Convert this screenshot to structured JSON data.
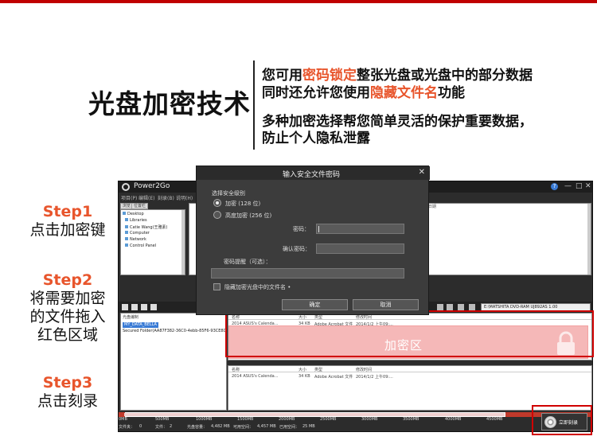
{
  "header": {
    "title": "光盘加密技术",
    "line1_pre": "您可用",
    "line1_hl": "密码锁定",
    "line1_post": "整张光盘或光盘中的部分数据",
    "line2_pre": "同时还允许您使用",
    "line2_hl": "隐藏文件名",
    "line2_post": "功能",
    "line3": "多种加密选择帮您简单灵活的保护重要数据，",
    "line4": "防止个人隐私泄露",
    "highlight_color": "#e8552c"
  },
  "steps": [
    {
      "head": "Step1",
      "lines": [
        "点击加密键"
      ]
    },
    {
      "head": "Step2",
      "lines": [
        "将需要加密",
        "的文件拖入",
        "红色区域"
      ]
    },
    {
      "head": "Step3",
      "lines": [
        "点击刻录"
      ]
    }
  ],
  "app": {
    "name": "Power2Go",
    "menu": [
      "项目(P)",
      "编辑(E)",
      "刻录(B)",
      "说明(H)"
    ],
    "tabs": [
      "浏览",
      "位置栏"
    ],
    "tree": [
      "Desktop",
      "Libraries",
      "Catie Wang(王雅素)",
      "Computer",
      "Network",
      "Control Panel"
    ],
    "top_right_col": "日期",
    "drive": "E:\\MATSHITA DVD-RAM UJ892AS 1.00",
    "left_pane_header": "光盘编制",
    "selected_item": "MY_DATA_BELLA",
    "left_item": "Secured Folder(AA87F382-36C0-4ebb-85F6-93CE8DB3",
    "columns": [
      "名称",
      "大小",
      "类型",
      "修改时间"
    ],
    "row": [
      "2014 ASUS's Calenda...",
      "34 KB",
      "Adobe Acrobat 文件",
      "2014/1/2 上午09:..."
    ],
    "encrypt_zone_label": "加密区",
    "columns2": [
      "名称",
      "大小",
      "类型",
      "修改时间"
    ],
    "row2": [
      "2014 ASUS's Calenda...",
      "34 KB",
      "Adobe Acrobat 文件",
      "2014/1/2 上午09:..."
    ],
    "scale": [
      "0MB",
      "500MB",
      "1000MB",
      "1500MB",
      "2000MB",
      "2500MB",
      "3000MB",
      "3500MB",
      "4000MB",
      "4500MB"
    ],
    "stats": [
      "文件夹：",
      "0",
      "文件：",
      "2",
      "光盘容量：",
      "4,482 MB",
      "可用空间：",
      "4,457 MB",
      "已用空间：",
      "25 MB"
    ],
    "burn_label": "立即刻录"
  },
  "dialog": {
    "title": "输入安全文件密码",
    "close": "✕",
    "security_level": "选择安全级别",
    "option1": "加密 (128 位)",
    "option2": "高度加密 (256 位)",
    "password_label": "密码：",
    "confirm_label": "确认密码：",
    "hint_label": "密码提醒（可选）：",
    "hide_names": "隐藏加密光盘中的文件名 •",
    "ok": "确定",
    "cancel": "取消"
  }
}
